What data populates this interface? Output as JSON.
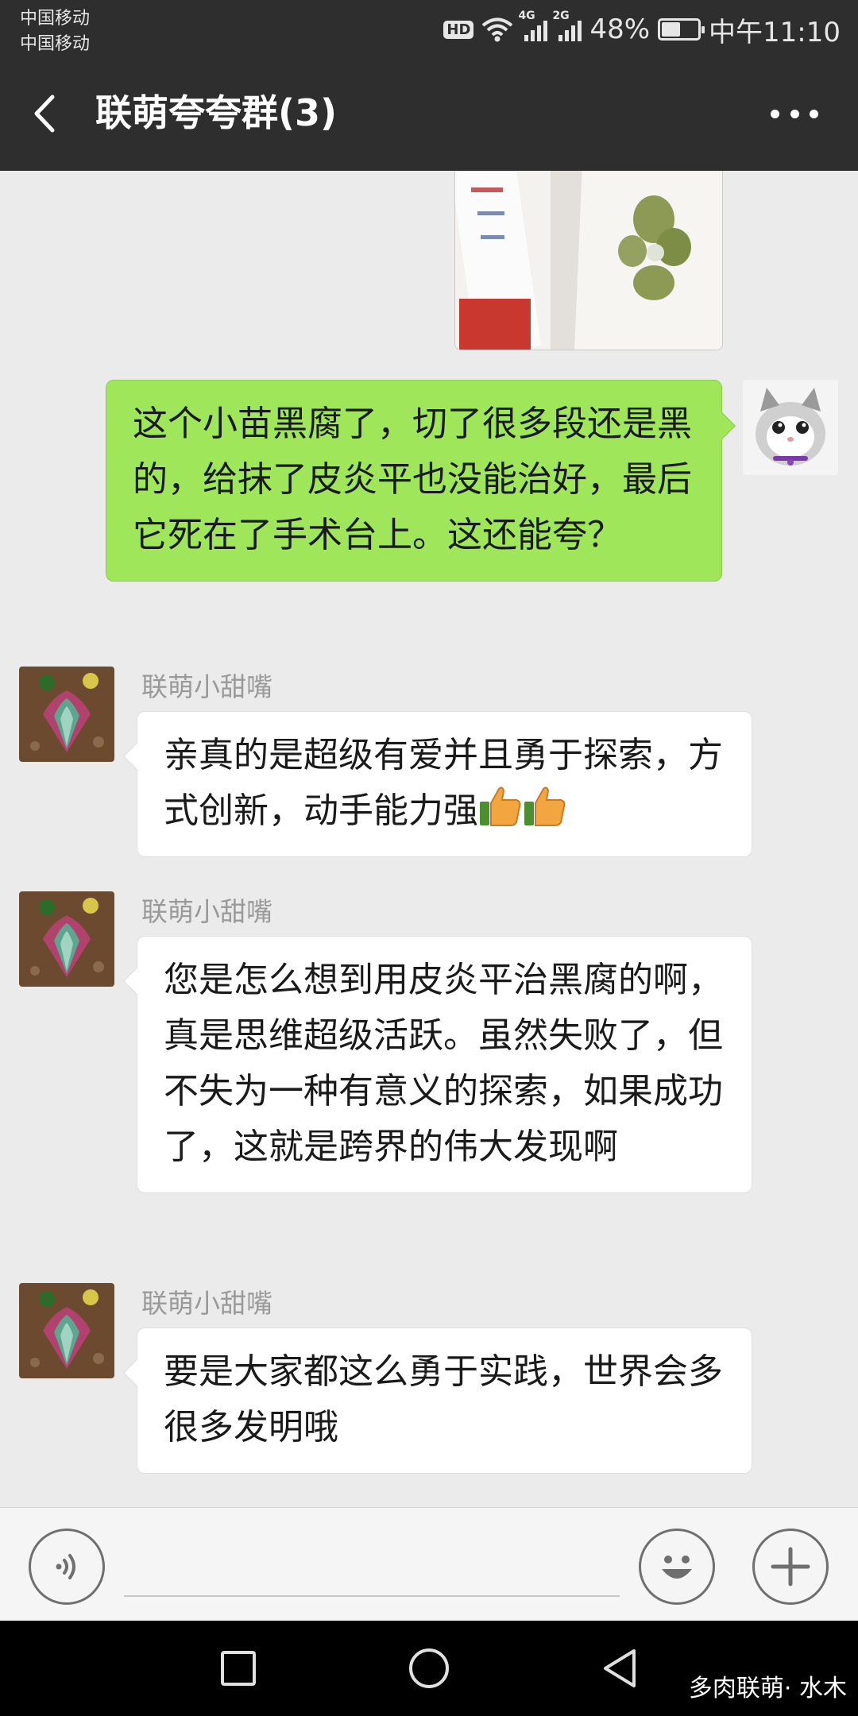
{
  "status_bar": {
    "carrier_1": "中国移动",
    "carrier_2": "中国移动",
    "hd_label": "HD",
    "sim1_network": "4G",
    "sim2_network": "2G",
    "battery_percent": "48%",
    "battery_level": 0.48,
    "time": "中午11:10"
  },
  "header": {
    "title": "联萌夸夸群(3)",
    "back_icon": "chevron-left-icon",
    "more_icon": "more-dots-icon"
  },
  "messages": [
    {
      "from": "me",
      "kind": "image",
      "content": "photo of a cut seedling on tissue paper"
    },
    {
      "from": "me",
      "kind": "text",
      "text": "这个小苗黑腐了，切了很多段还是黑的，给抹了皮炎平也没能治好，最后它死在了手术台上。这还能夸？"
    },
    {
      "from": "them",
      "sender": "联萌小甜嘴",
      "kind": "text",
      "text": "亲真的是超级有爱并且勇于探索，方式创新，动手能力强",
      "emoji": [
        "thumbs-up-icon",
        "thumbs-up-icon"
      ]
    },
    {
      "from": "them",
      "sender": "联萌小甜嘴",
      "kind": "text",
      "text": "您是怎么想到用皮炎平治黑腐的啊，真是思维超级活跃。虽然失败了，但不失为一种有意义的探索，如果成功了，这就是跨界的伟大发现啊"
    },
    {
      "from": "them",
      "sender": "联萌小甜嘴",
      "kind": "text",
      "text": "要是大家都这么勇于实践，世界会多很多发明哦"
    }
  ],
  "input_bar": {
    "voice_icon": "voice-icon",
    "input_value": "",
    "emoji_icon": "smiley-icon",
    "plus_icon": "plus-icon"
  },
  "nav_bar": {
    "recents_icon": "square-icon",
    "home_icon": "circle-icon",
    "back_icon": "triangle-back-icon",
    "watermark": "多肉联萌· 水木"
  },
  "colors": {
    "header_bg": "#2e2e2e",
    "chat_bg": "#ebebeb",
    "my_bubble": "#9fe65a",
    "their_bubble": "#ffffff"
  }
}
